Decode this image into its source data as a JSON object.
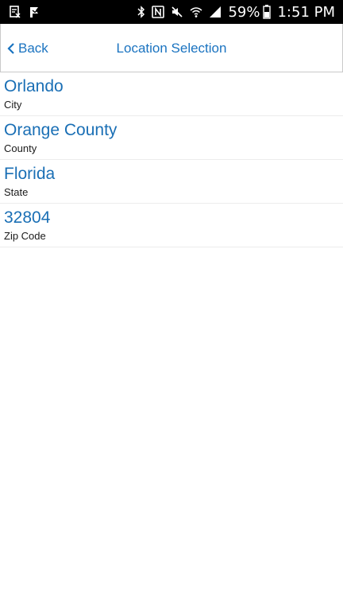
{
  "status_bar": {
    "battery_percent": "59%",
    "time": "1:51 PM",
    "icons_left": [
      "document-icon",
      "flag-icon"
    ],
    "icons_right": [
      "bluetooth-icon",
      "nfc-icon",
      "mute-icon",
      "wifi-icon",
      "signal-icon",
      "battery-icon"
    ]
  },
  "nav": {
    "back_label": "Back",
    "title": "Location Selection"
  },
  "items": [
    {
      "value": "Orlando",
      "type": "City"
    },
    {
      "value": "Orange County",
      "type": "County"
    },
    {
      "value": "Florida",
      "type": "State"
    },
    {
      "value": "32804",
      "type": "Zip Code"
    }
  ],
  "colors": {
    "accent": "#1a73c0",
    "status_bar": "#000000"
  }
}
